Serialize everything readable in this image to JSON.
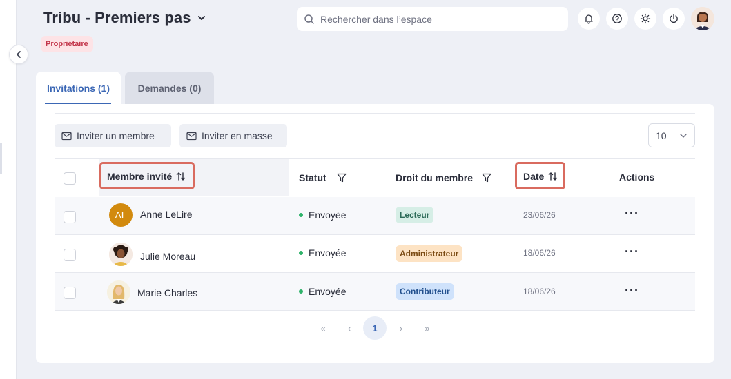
{
  "header": {
    "title": "Tribu - Premiers pas",
    "role_badge": "Propriétaire",
    "search_placeholder": "Rechercher dans l’espace"
  },
  "tabs": [
    {
      "label": "Invitations (1)",
      "active": true
    },
    {
      "label": "Demandes (0)",
      "active": false
    }
  ],
  "toolbar": {
    "invite_member": "Inviter un membre",
    "invite_bulk": "Inviter en masse",
    "page_size": "10"
  },
  "table": {
    "columns": {
      "member": "Membre invité",
      "status": "Statut",
      "role": "Droit du membre",
      "date": "Date",
      "actions": "Actions"
    },
    "rows": [
      {
        "initials": "AL",
        "name": "Anne LeLire",
        "status": "Envoyée",
        "role": "Lecteur",
        "date": "23/06/26",
        "actions": "···"
      },
      {
        "initials": "",
        "name": "Julie Moreau",
        "status": "Envoyée",
        "role": "Administrateur",
        "date": "18/06/26",
        "actions": "···"
      },
      {
        "initials": "",
        "name": "Marie Charles",
        "status": "Envoyée",
        "role": "Contributeur",
        "date": "18/06/26",
        "actions": "···"
      }
    ]
  },
  "pagination": {
    "first": "«",
    "prev": "‹",
    "current": "1",
    "next": "›",
    "last": "»"
  },
  "colors": {
    "accent": "#3b67b5",
    "highlight": "#d96b5f",
    "status_sent": "#2fb36a",
    "role_lecteur_bg": "#d6eee6",
    "role_admin_bg": "#fde3c4",
    "role_contrib_bg": "#cfe2fb"
  }
}
